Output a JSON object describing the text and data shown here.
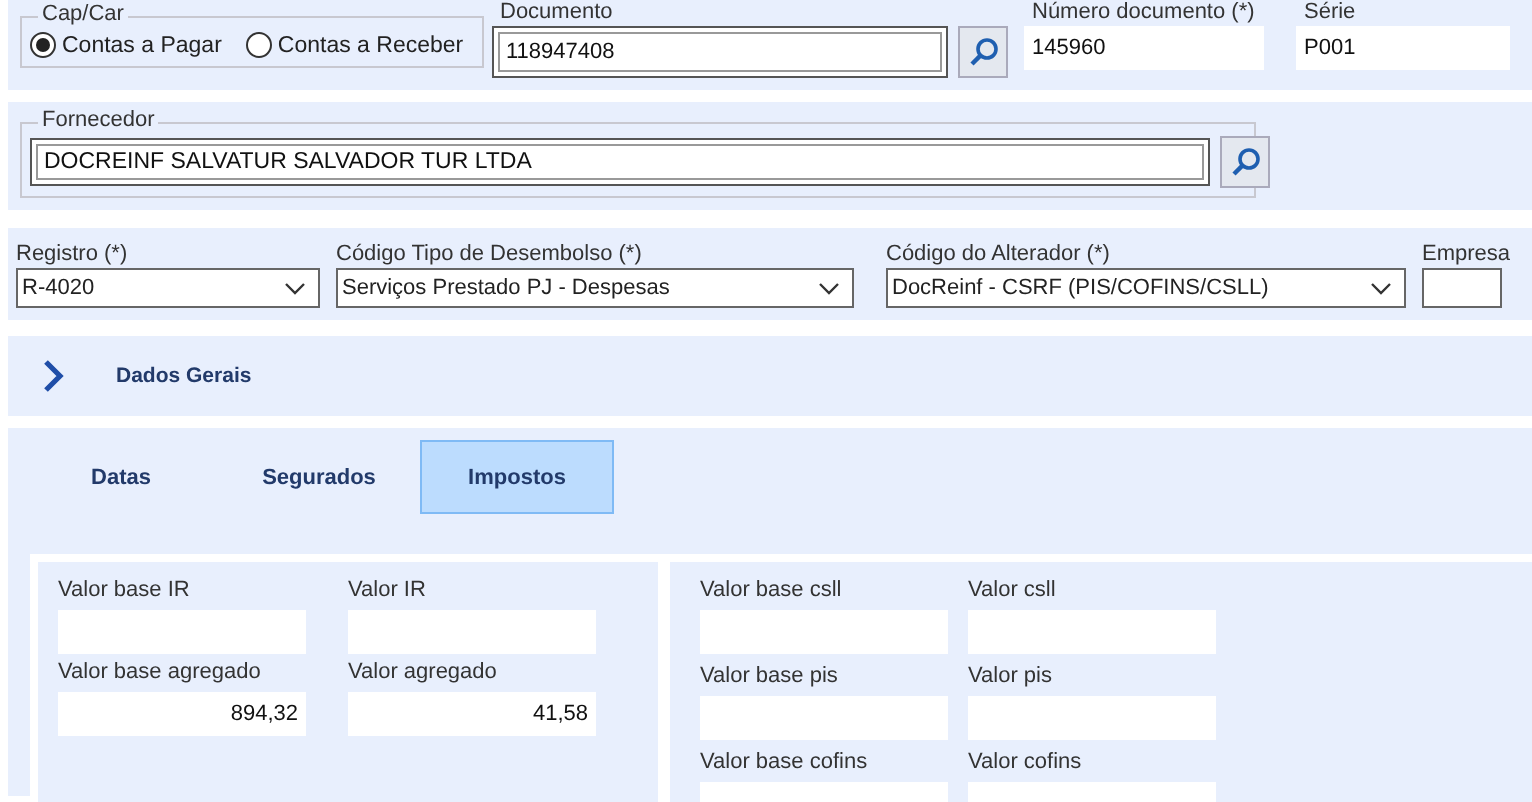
{
  "cap_car": {
    "legend": "Cap/Car",
    "options": [
      {
        "label": "Contas a Pagar",
        "selected": true
      },
      {
        "label": "Contas a Receber",
        "selected": false
      }
    ]
  },
  "documento": {
    "label": "Documento",
    "value": "118947408"
  },
  "numero_documento": {
    "label": "Número documento (*)",
    "value": "145960"
  },
  "serie": {
    "label": "Série",
    "value": "P001"
  },
  "fornecedor": {
    "legend": "Fornecedor",
    "value": "DOCREINF SALVATUR SALVADOR TUR LTDA"
  },
  "selects": [
    {
      "label": "Registro (*)",
      "value": "R-4020"
    },
    {
      "label": "Código Tipo de Desembolso (*)",
      "value": "Serviços Prestado PJ - Despesas"
    },
    {
      "label": "Código do Alterador (*)",
      "value": "DocReinf - CSRF (PIS/COFINS/CSLL)"
    },
    {
      "label": "Empresa"
    }
  ],
  "section": {
    "title": "Dados Gerais",
    "expanded": false
  },
  "tabs": [
    {
      "label": "Datas",
      "selected": false
    },
    {
      "label": "Segurados",
      "selected": false
    },
    {
      "label": "Impostos",
      "selected": true
    }
  ],
  "tax_groups": [
    {
      "fields": [
        {
          "label": "Valor base IR"
        },
        {
          "label": "Valor IR"
        },
        {
          "label": "Valor base agregado",
          "value": "894,32"
        },
        {
          "label": "Valor agregado",
          "value": "41,58"
        }
      ]
    },
    {
      "fields": [
        {
          "label": "Valor base csll"
        },
        {
          "label": "Valor csll"
        },
        {
          "label": "Valor base pis"
        },
        {
          "label": "Valor pis"
        },
        {
          "label": "Valor base cofins"
        },
        {
          "label": "Valor cofins"
        }
      ]
    }
  ]
}
